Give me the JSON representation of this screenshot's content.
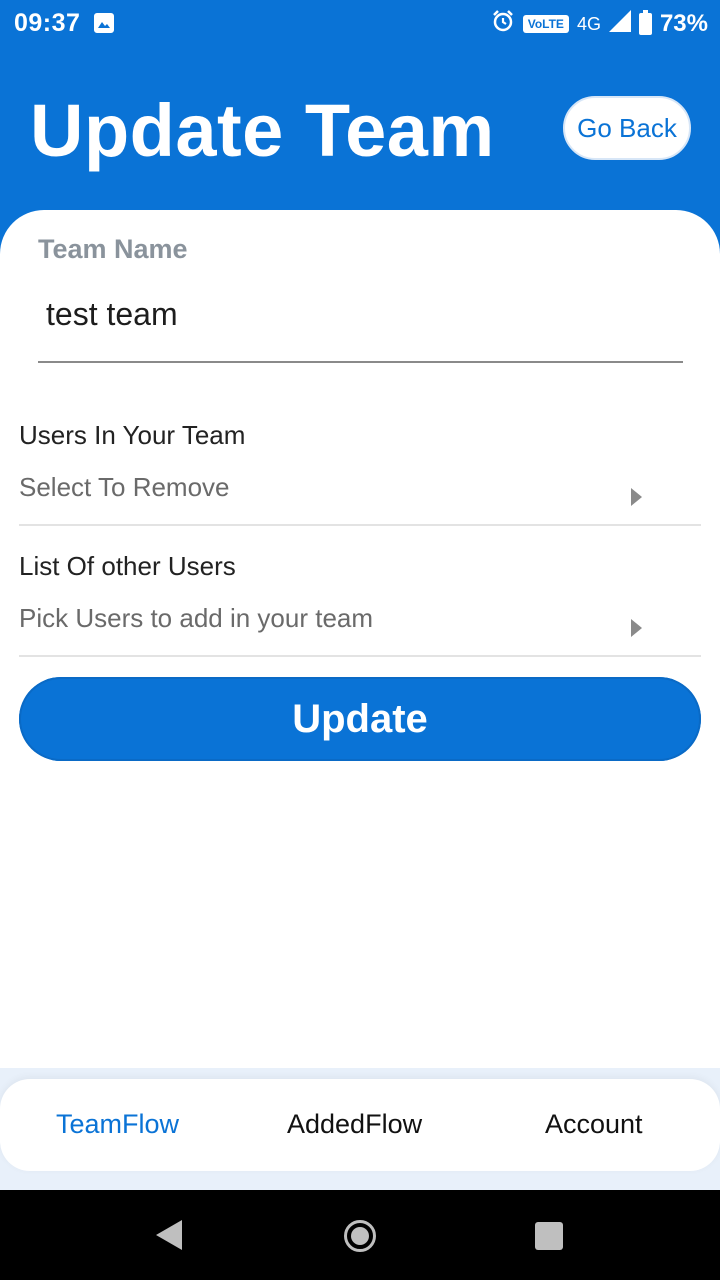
{
  "status_bar": {
    "time": "09:37",
    "volte": "VoLTE",
    "network": "4G",
    "battery": "73%"
  },
  "header": {
    "title": "Update Team",
    "go_back_label": "Go Back"
  },
  "form": {
    "team_name_label": "Team Name",
    "team_name_value": "test team",
    "users_section_title": "Users In Your Team",
    "users_dropdown_placeholder": "Select To Remove",
    "other_users_section_title": "List Of other Users",
    "other_users_dropdown_placeholder": "Pick Users to add in your team",
    "update_label": "Update"
  },
  "bottom_nav": {
    "items": [
      {
        "label": "TeamFlow",
        "active": true
      },
      {
        "label": "AddedFlow",
        "active": false
      },
      {
        "label": "Account",
        "active": false
      }
    ]
  },
  "colors": {
    "primary": "#0a73d6",
    "label_gray": "#8a939c"
  },
  "icons": {
    "status": [
      "image-icon",
      "alarm-icon",
      "signal-icon",
      "battery-icon"
    ],
    "system_nav": [
      "back-icon",
      "home-icon",
      "recents-icon"
    ]
  }
}
